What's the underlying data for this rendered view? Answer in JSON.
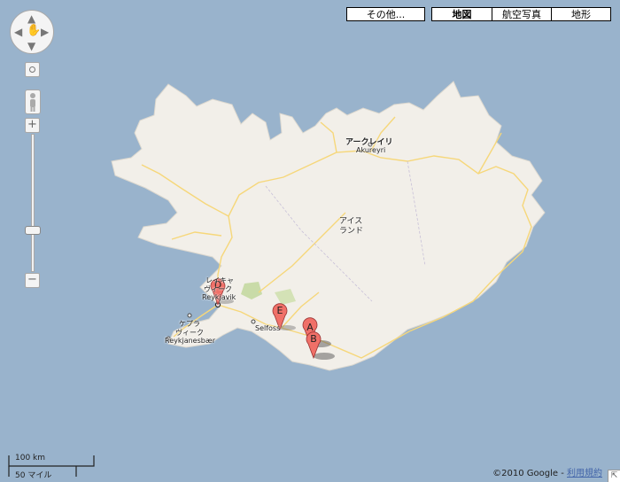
{
  "map_type_buttons": {
    "more": "その他...",
    "map": "地図",
    "satellite": "航空写真",
    "terrain": "地形"
  },
  "zoom": {
    "plus": "+",
    "minus": "−"
  },
  "place_labels": {
    "akureyri_jp": "アークレイリ",
    "akureyri_en": "Akureyri",
    "iceland_line1": "アイス",
    "iceland_line2": "ランド",
    "reykjavik_jp1": "レイキャ",
    "reykjavik_jp2": "ヴィーク",
    "reykjavik_en": "Reykjavik",
    "keflavik_jp1": "ケプラ",
    "keflavik_jp2": "ヴィーク",
    "reykjanesbaer": "Reykjanesbær",
    "selfoss": "Selfoss"
  },
  "markers": [
    {
      "letter": "D"
    },
    {
      "letter": "E"
    },
    {
      "letter": "A"
    },
    {
      "letter": "B"
    }
  ],
  "scale": {
    "km": "100 km",
    "miles": "50 マイル"
  },
  "copyright": {
    "text": "©2010 Google - ",
    "terms_link": "利用規約"
  },
  "colors": {
    "water": "#99b3cc",
    "land": "#f2efe9",
    "road": "#f6d77a",
    "park": "#c9dba8",
    "marker": "#f07068"
  }
}
